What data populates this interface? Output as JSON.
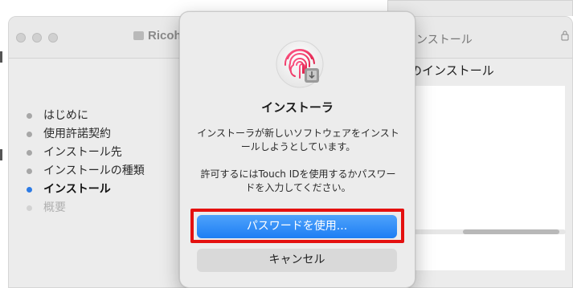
{
  "background_window": {
    "title": "Ricoh_",
    "title_right": "ンストール",
    "content_heading": "のインストール",
    "steps": [
      {
        "label": "はじめに",
        "state": "normal"
      },
      {
        "label": "使用許諾契約",
        "state": "normal"
      },
      {
        "label": "インストール先",
        "state": "normal"
      },
      {
        "label": "インストールの種類",
        "state": "normal"
      },
      {
        "label": "インストール",
        "state": "active"
      },
      {
        "label": "概要",
        "state": "disabled"
      }
    ],
    "progress_fraction": 0.6
  },
  "dialog": {
    "icon": "touch-id-fingerprint-icon",
    "title": "インストーラ",
    "message": "インストーラが新しいソフトウェアをインストールしようとしています。",
    "prompt": "許可するにはTouch IDを使用するかパスワードを入力してください。",
    "primary_button": "パスワードを使用...",
    "cancel_button": "キャンセル"
  },
  "colors": {
    "accent_blue": "#1d7ef4",
    "highlight_red": "#e4100f",
    "active_step_dot": "#2c7be5"
  }
}
